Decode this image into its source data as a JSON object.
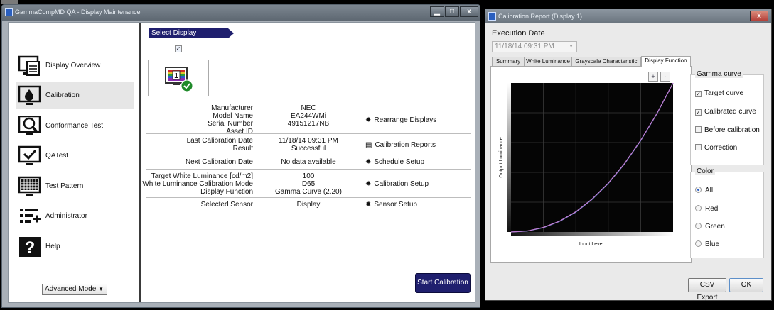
{
  "window1": {
    "title": "GammaCompMD QA - Display Maintenance",
    "buttons": {
      "minimize": "▁",
      "maximize": "□",
      "close": "x"
    }
  },
  "sidebar": {
    "items": [
      {
        "label": "Display Overview",
        "icon": "display-overview-icon",
        "selected": false
      },
      {
        "label": "Calibration",
        "icon": "calibration-icon",
        "selected": true
      },
      {
        "label": "Conformance Test",
        "icon": "conformance-test-icon",
        "selected": false
      },
      {
        "label": "QATest",
        "icon": "qatest-icon",
        "selected": false
      },
      {
        "label": "Test Pattern",
        "icon": "test-pattern-icon",
        "selected": false
      },
      {
        "label": "Administrator",
        "icon": "administrator-icon",
        "selected": false
      },
      {
        "label": "Help",
        "icon": "help-icon",
        "selected": false
      }
    ],
    "mode_select": "Advanced Mode"
  },
  "main": {
    "select_display_label": "Select Display",
    "display_tab_number": "1",
    "rows": {
      "display": {
        "labels": [
          "Manufacturer",
          "Model Name",
          "Serial Number",
          "Asset ID"
        ],
        "values": [
          "NEC",
          "EA244WMi",
          "49151217NB",
          ""
        ],
        "action": "Rearrange Displays"
      },
      "calibration": {
        "labels": [
          "Last Calibration Date",
          "Result"
        ],
        "values": [
          "11/18/14 09:31 PM",
          "Successful"
        ],
        "action": "Calibration Reports"
      },
      "next": {
        "labels": [
          "Next Calibration Date"
        ],
        "values": [
          "No data available"
        ],
        "action": "Schedule Setup"
      },
      "target": {
        "labels": [
          "Target White Luminance [cd/m2]",
          "White Luminance Calibration Mode",
          "Display Function"
        ],
        "values": [
          "100",
          "D65",
          "Gamma Curve (2.20)"
        ],
        "action": "Calibration Setup"
      },
      "sensor": {
        "labels": [
          "Selected Sensor"
        ],
        "values": [
          "Display"
        ],
        "action": "Sensor Setup"
      }
    },
    "start_button": "Start Calibration"
  },
  "window2": {
    "title": "Calibration Report (Display 1)",
    "close": "x",
    "execution_date_label": "Execution Date",
    "execution_date_value": "11/18/14 09:31 PM",
    "tabs": [
      "Summary",
      "White Luminance",
      "Grayscale Characteristic",
      "Display Function"
    ],
    "active_tab": 3,
    "zoom_in": "+",
    "zoom_out": "-",
    "gamma_group": {
      "title": "Gamma curve",
      "options": [
        {
          "label": "Target curve",
          "checked": true
        },
        {
          "label": "Calibrated curve",
          "checked": true
        },
        {
          "label": "Before calibration",
          "checked": false
        },
        {
          "label": "Correction",
          "checked": false
        }
      ]
    },
    "color_group": {
      "title": "Color",
      "options": [
        {
          "label": "All",
          "selected": true
        },
        {
          "label": "Red",
          "selected": false
        },
        {
          "label": "Green",
          "selected": false
        },
        {
          "label": "Blue",
          "selected": false
        }
      ]
    },
    "csv_button": "CSV Export",
    "ok_button": "OK"
  },
  "chart_data": {
    "type": "line",
    "xlabel": "Input Level",
    "ylabel": "Output Luminance",
    "xlim": [
      0,
      1
    ],
    "ylim": [
      0,
      1
    ],
    "grid": true,
    "series": [
      {
        "x": [
          0,
          0.1,
          0.2,
          0.3,
          0.4,
          0.5,
          0.6,
          0.7,
          0.8,
          0.9,
          1.0
        ],
        "values": [
          0,
          0.006,
          0.029,
          0.071,
          0.133,
          0.218,
          0.325,
          0.456,
          0.612,
          0.793,
          1.0
        ],
        "color": "#6a8ed8"
      },
      {
        "x": [
          0,
          0.1,
          0.2,
          0.3,
          0.4,
          0.5,
          0.6,
          0.7,
          0.8,
          0.9,
          1.0
        ],
        "values": [
          0,
          0.007,
          0.031,
          0.073,
          0.136,
          0.221,
          0.328,
          0.459,
          0.615,
          0.795,
          1.0
        ],
        "color": "#c07ad0"
      }
    ]
  }
}
